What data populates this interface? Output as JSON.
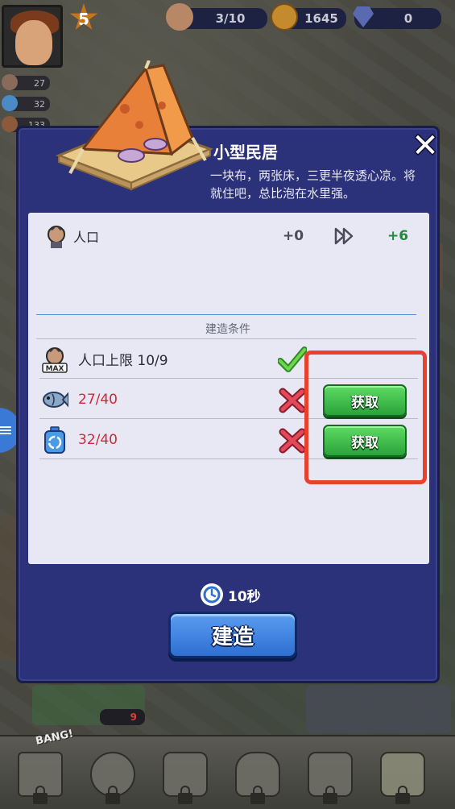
{
  "hud": {
    "level": "5",
    "population": "3/10",
    "coins": "1645",
    "gems": "0"
  },
  "side_stats": [
    "27",
    "32",
    "133"
  ],
  "ground_badge": "9",
  "modal": {
    "title": "小型民居",
    "description": "一块布，两张床，三更半夜透心凉。将就住吧，总比泡在水里强。",
    "close_glyph": "✕",
    "population_row": {
      "label": "人口",
      "current": "+0",
      "next": "+6"
    },
    "section_label": "建造条件",
    "conditions": [
      {
        "text": "人口上限 10/9",
        "status": "met",
        "icon": "survivor-max-icon",
        "icon_badge": "MAX"
      },
      {
        "text": "27/40",
        "status": "unmet",
        "icon": "fish-icon",
        "action": "获取"
      },
      {
        "text": "32/40",
        "status": "unmet",
        "icon": "recycle-bottle-icon",
        "action": "获取"
      }
    ],
    "timer": "10秒",
    "build_button": "建造"
  },
  "bottom_nav": {
    "bang_label": "BANG!",
    "items": [
      "ship-icon",
      "survivor-icon",
      "crates-icon",
      "hand-coins-icon",
      "handshake-icon",
      "map-icon"
    ]
  },
  "colors": {
    "modal_bg": "#2c327a",
    "get_button": "#3fbf4a",
    "build_button": "#3d84e0",
    "highlight": "#e8412e",
    "unmet_text": "#d3283a",
    "met_check": "#4cc23a"
  }
}
